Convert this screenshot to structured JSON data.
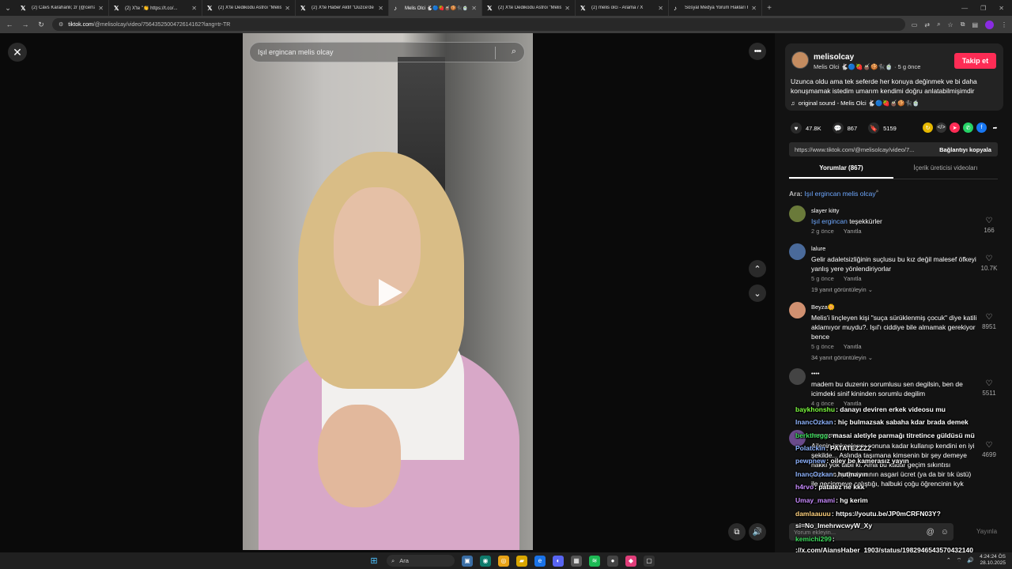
{
  "browser": {
    "tabs": [
      {
        "icon": "x-logo",
        "title": "(2) Cävs Karahanli; zr (@cerrahpi..."
      },
      {
        "icon": "x-logo",
        "title": "(2) X'te \"👏 https://t.co/..."
      },
      {
        "icon": "x-logo",
        "title": "(2) X'te Dedikodu Astroi \"Melis"
      },
      {
        "icon": "x-logo",
        "title": "(2) X'te Haber Aktif \"Düzce'de"
      },
      {
        "icon": "tiktok-logo",
        "title": "Melis Olci 🐇🔵🍓🧉🍪🐈‍⬛🍵"
      },
      {
        "icon": "x-logo",
        "title": "(2) X'te Dedikodu Astroi \"Melis"
      },
      {
        "icon": "x-logo",
        "title": "(2) melis olci - Arama / X"
      },
      {
        "icon": "tiktok-logo",
        "title": "Sosyal Medya Yorum Hakları Hu..."
      }
    ],
    "url_domain": "tiktok.com",
    "url_path": "/@melisolcay/video/7564352500472614162?lang=tr-TR"
  },
  "video": {
    "search_text": "Işıl ergincan melis olcay"
  },
  "author": {
    "username": "melisolcay",
    "nickname_line": "Melis Olci 🐇🔵🍓🧉🍪🐈‍⬛🍵 · 5 g önce",
    "follow_label": "Takip et",
    "caption": "Uzunca oldu ama tek seferde her konuya değinmek ve bi daha konuşmamak istedim umarım kendimi doğru anlatabilmişimdir",
    "sound": "original sound - Melis Olci 🐇🔵🍓🧉🍪🐈‍⬛🍵"
  },
  "stats": {
    "likes": "47.8K",
    "comments": "867",
    "saves": "5159"
  },
  "share": {
    "link": "https://www.tiktok.com/@melisolcay/video/7...",
    "copy_label": "Bağlantıyı kopyala"
  },
  "panel_tabs": {
    "comments": "Yorumlar (867)",
    "creator_videos": "İçerik üreticisi videoları"
  },
  "search_hint": {
    "prefix": "Ara:",
    "term": "Işıl ergincan melis olcay"
  },
  "comments": [
    {
      "user": "slayer kitty",
      "mention": "Işıl ergincan",
      "text": "teşekkürler",
      "meta": "2 g önce",
      "reply": "Yanıtla",
      "likes": "166",
      "replies": ""
    },
    {
      "user": "lalure",
      "mention": "",
      "text": "Gelir adaletsizliğinin suçlusu bu kız değil malesef öfkeyi yanlış yere yönlendiriyorlar",
      "meta": "5 g önce",
      "reply": "Yanıtla",
      "likes": "10.7K",
      "replies": "19 yanıt görüntüleyin"
    },
    {
      "user": "Beyza🌼",
      "mention": "",
      "text": "Melis'i linçleyen kişi \"suça sürüklenmiş çocuk\" diye katili aklamıyor muydu?. Işıl'ı ciddiye bile almamak gerekiyor bence",
      "meta": "5 g önce",
      "reply": "Yanıtla",
      "likes": "8951",
      "replies": "34 yanıt görüntüleyin"
    },
    {
      "user": "••••",
      "mention": "",
      "text": "madem bu duzenin sorumlusu sen degilsin, ben de icimdeki sinif kininden sorumlu degilim",
      "meta": "4 g önce",
      "reply": "Yanıtla",
      "likes": "5511",
      "replies": ""
    },
    {
      "user": "asenayıvn",
      "mention": "",
      "text": "Ailenin imkanlarını sonuna kadar kullanıp kendini en iyi şekilde... Aslında taşımana kimsenin bir şey demeye hakkı yok tabii ki. Ama bu kadar geçim sıkıntısı yaşanan, çoğu insanın asgari ücret (ya da bir tık üstü) ile geçinmeye çalıştığı, halbuki çoğu öğrencinin kyk bursuyla yaşadığı ülkede bu kadar türkiye şartlarını güzelleme yapılması insanları kin ve nefrete sürüklüyor.",
      "meta": "",
      "reply": "",
      "likes": "4699",
      "replies": ""
    }
  ],
  "comment_input": {
    "placeholder": "Yorum ekleyin...",
    "post_label": "Yayınla"
  },
  "chat_overlay": [
    {
      "user": "baykhonshu",
      "color": "#7fff3f",
      "text": ": danayı deviren erkek videosu mu"
    },
    {
      "user": "InancOzkan",
      "color": "#8fb4ff",
      "text": ": hiç bulmazsak sabaha kdar brada demek"
    },
    {
      "user": "berkthegg",
      "color": "#3fdf5f",
      "text": ": masai aletiyle parmağı titretince güldüsü mü"
    },
    {
      "user": "Polatckin",
      "color": "#8fb4ff",
      "text": ": PATATEZZZZ"
    },
    {
      "user": "pewpnew",
      "color": "#8fb4ff",
      "text": ": oiley be kamerasız yayın"
    },
    {
      "user": "InancOzkan",
      "color": "#8fb4ff",
      "text": ": hutmayın"
    },
    {
      "user": "h4rvo",
      "color": "#c98bff",
      "text": ": patatez ne kkk"
    },
    {
      "user": "Umay_mami",
      "color": "#c98bff",
      "text": ": hg kerim"
    },
    {
      "user": "damlaauuu",
      "color": "#ffd27f",
      "text": ": https://youtu.be/JP0mCRFN03Y?"
    },
    {
      "user": "",
      "color": "#ffffff",
      "text": "si=No_ImehrwcwyW_Xy"
    },
    {
      "user": "kemichi299",
      "color": "#3fdf5f",
      "text": ":"
    },
    {
      "user": "",
      "color": "#ffffff",
      "text": "://x.com/AjansHaber_1903/status/1982946543570432140"
    }
  ],
  "taskbar": {
    "search_label": "Ara",
    "time": "4:24:24 ÖS",
    "date": "28.10.2025"
  }
}
